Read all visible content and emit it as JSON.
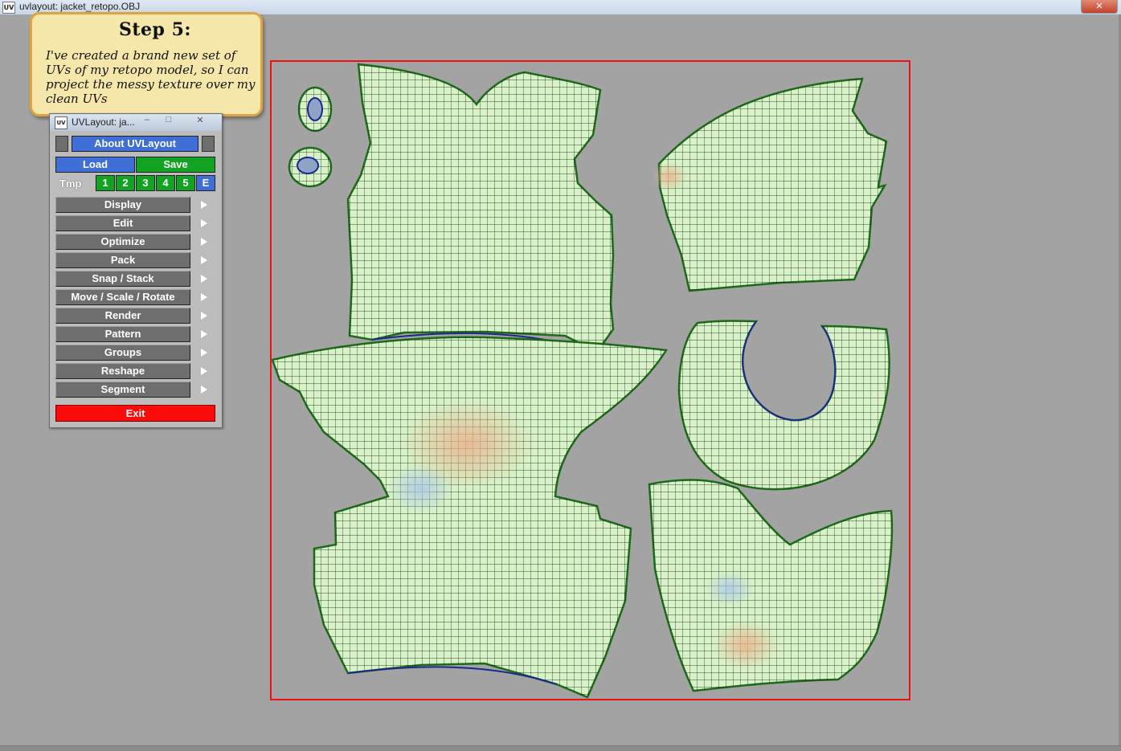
{
  "window": {
    "title": "uvlayout: jacket_retopo.OBJ",
    "icon": "uv-app-icon"
  },
  "callout": {
    "heading": "Step 5:",
    "text": "I've created a brand new set of UVs of my retopo model, so I can project the messy texture over my clean UVs"
  },
  "palette": {
    "title": "UVLayout: ja...",
    "about": "About UVLayout",
    "load": "Load",
    "save": "Save",
    "tmp_label": "Tmp",
    "tmp_slots": [
      "1",
      "2",
      "3",
      "4",
      "5",
      "E"
    ],
    "menu": [
      "Display",
      "Edit",
      "Optimize",
      "Pack",
      "Snap / Stack",
      "Move / Scale / Rotate",
      "Render",
      "Pattern",
      "Groups",
      "Reshape",
      "Segment"
    ],
    "exit": "Exit"
  },
  "colors": {
    "shell_fill": "#d6f2c6",
    "shell_border": "#1d6b18",
    "grid_line": "#111111",
    "uv_bounds": "#ee1111",
    "background": "#a3a3a3"
  }
}
